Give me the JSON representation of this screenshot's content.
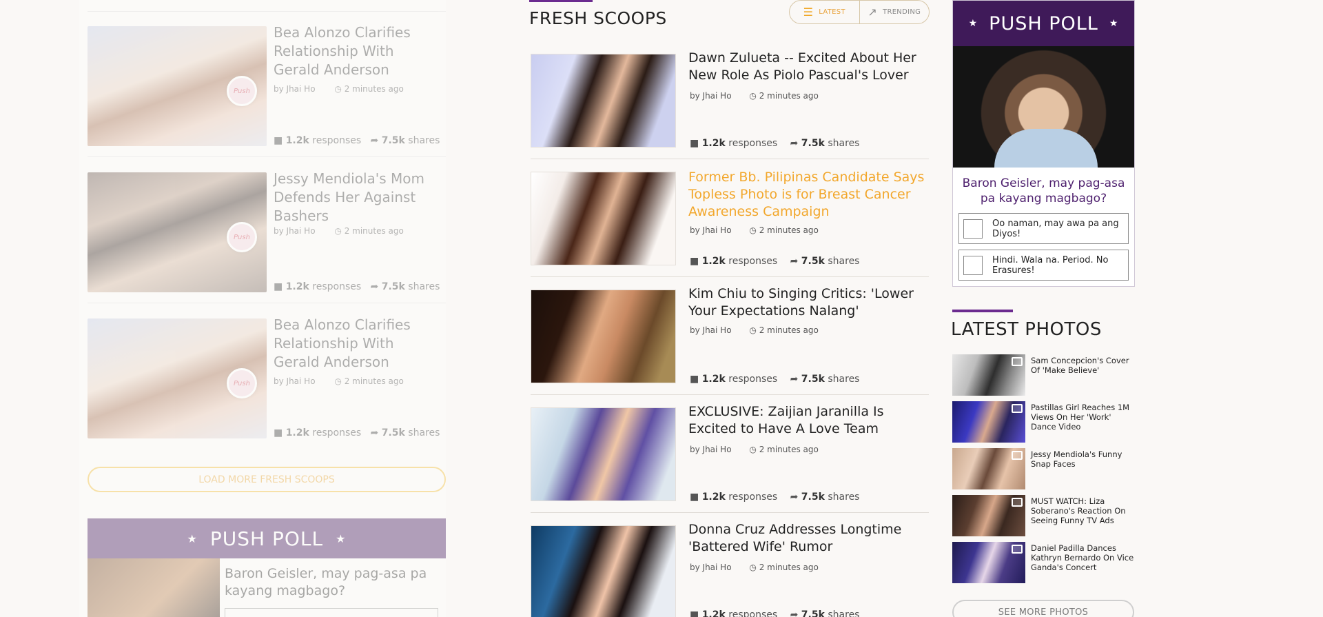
{
  "left_feed": {
    "items": [
      {
        "title": "Bea Alonzo Clarifies Relationship With Gerald Anderson",
        "author": "by Jhai Ho",
        "time": "2 minutes ago",
        "responses_count": "1.2k",
        "responses_label": "responses",
        "shares_count": "7.5k",
        "shares_label": "shares",
        "badge": "Push"
      },
      {
        "title": "Jessy Mendiola's Mom Defends Her Against Bashers",
        "author": "by Jhai Ho",
        "time": "2 minutes ago",
        "responses_count": "1.2k",
        "responses_label": "responses",
        "shares_count": "7.5k",
        "shares_label": "shares",
        "badge": "Push"
      },
      {
        "title": "Bea Alonzo Clarifies Relationship With Gerald Anderson",
        "author": "by Jhai Ho",
        "time": "2 minutes ago",
        "responses_count": "1.2k",
        "responses_label": "responses",
        "shares_count": "7.5k",
        "shares_label": "shares",
        "badge": "Push"
      }
    ],
    "load_more_label": "LOAD MORE FRESH SCOOPS",
    "poll_title": "PUSH POLL",
    "poll_question": "Baron Geisler, may pag-asa pa kayang magbago?"
  },
  "fresh_scoops": {
    "title": "FRESH SCOOPS",
    "toggle": {
      "latest": "LATEST",
      "trending": "TRENDING"
    },
    "items": [
      {
        "title": "Dawn Zulueta -- Excited About Her New Role As Piolo Pascual's Lover",
        "author": "by Jhai Ho",
        "time": "2 minutes ago",
        "responses_count": "1.2k",
        "responses_label": "responses",
        "shares_count": "7.5k",
        "shares_label": "shares"
      },
      {
        "title": "Former Bb. Pilipinas Candidate Says Topless Photo is for Breast Cancer Awareness Campaign",
        "author": "by Jhai Ho",
        "time": "2 minutes ago",
        "responses_count": "1.2k",
        "responses_label": "responses",
        "shares_count": "7.5k",
        "shares_label": "shares"
      },
      {
        "title": "Kim Chiu to Singing Critics: 'Lower Your Expectations Nalang'",
        "author": "by Jhai Ho",
        "time": "2 minutes ago",
        "responses_count": "1.2k",
        "responses_label": "responses",
        "shares_count": "7.5k",
        "shares_label": "shares"
      },
      {
        "title": "EXCLUSIVE: Zaijian Jaranilla Is Excited to Have A Love Team",
        "author": "by Jhai Ho",
        "time": "2 minutes ago",
        "responses_count": "1.2k",
        "responses_label": "responses",
        "shares_count": "7.5k",
        "shares_label": "shares"
      },
      {
        "title": "Donna Cruz Addresses Longtime 'Battered Wife' Rumor",
        "author": "by Jhai Ho",
        "time": "2 minutes ago",
        "responses_count": "1.2k",
        "responses_label": "responses",
        "shares_count": "7.5k",
        "shares_label": "shares"
      }
    ]
  },
  "push_poll": {
    "title": "PUSH POLL",
    "question": "Baron Geisler, may pag-asa pa kayang magbago?",
    "options": [
      "Oo naman, may awa pa ang Diyos!",
      "Hindi. Wala na. Period. No Erasures!"
    ]
  },
  "latest_photos": {
    "title": "LATEST PHOTOS",
    "items": [
      {
        "caption": "Sam Concepcion's Cover Of 'Make Believe'"
      },
      {
        "caption": "Pastillas Girl Reaches 1M Views On Her 'Work' Dance Video"
      },
      {
        "caption": "Jessy Mendiola's Funny Snap Faces"
      },
      {
        "caption": "MUST WATCH: Liza Soberano's Reaction On Seeing Funny TV Ads"
      },
      {
        "caption": "Daniel Padilla Dances Kathryn Bernardo On Vice Ganda's Concert"
      }
    ],
    "see_more_label": "SEE MORE PHOTOS"
  },
  "colors": {
    "accent_orange": "#f2a72c",
    "brand_purple": "#4d1f6d",
    "divider": "#e0dcd6"
  },
  "icons": {
    "latest": "list-lines-icon",
    "trending": "trend-arrow-icon",
    "responses": "comment-icon",
    "shares": "share-arrow-icon",
    "time": "clock-icon",
    "gallery": "gallery-icon"
  }
}
